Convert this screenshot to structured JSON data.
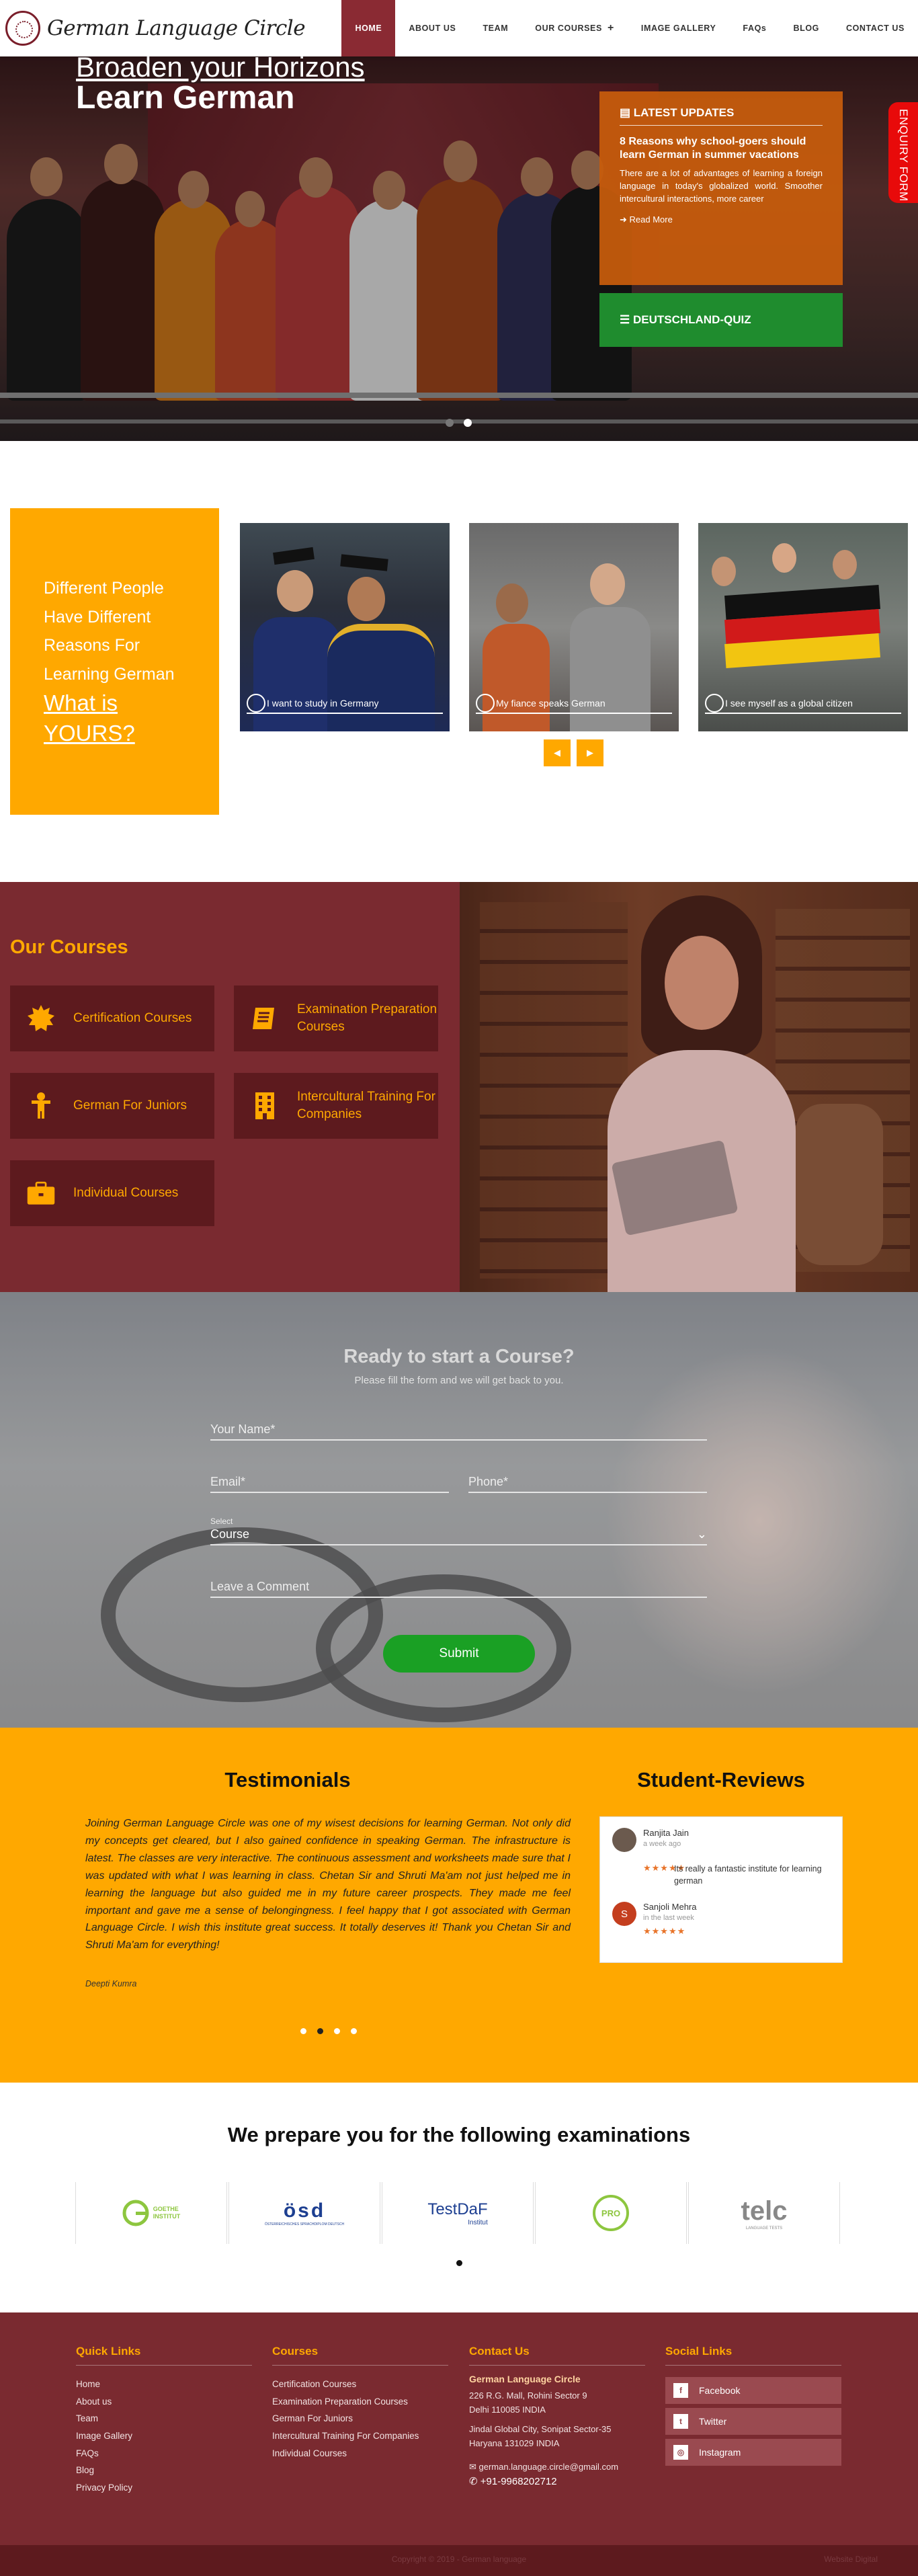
{
  "brand": {
    "name": "German Language Circle"
  },
  "nav": {
    "home": "HOME",
    "about": "ABOUT US",
    "team": "TEAM",
    "courses": "OUR COURSES",
    "gallery": "IMAGE GALLERY",
    "faqs": "FAQs",
    "blog": "BLOG",
    "contact": "CONTACT US"
  },
  "hero": {
    "line1": "Broaden your Horizons",
    "line2": "Learn German",
    "updates_heading": "LATEST UPDATES",
    "article_title": "8 Reasons why school-goers should learn German in summer vacations",
    "article_excerpt": "There are a lot of advantages of learning a foreign language in today's globalized world. Smoother intercultural interactions, more career",
    "read_more": "Read More",
    "quiz_label": "DEUTSCHLAND-QUIZ",
    "enquiry_label": "ENQUIRY FORM"
  },
  "reasons": {
    "lead": "Different People Have Different Reasons For Learning German",
    "question": "What is YOURS?",
    "cards": [
      {
        "caption": "I want to study in Germany"
      },
      {
        "caption": "My fiance speaks German"
      },
      {
        "caption": "I see myself as a global citizen"
      }
    ],
    "prev_glyph": "◀",
    "next_glyph": "▶"
  },
  "courses": {
    "title": "Our Courses",
    "items": [
      {
        "label": "Certification Courses",
        "icon": "certificate-icon"
      },
      {
        "label": "Examination Preparation Courses",
        "icon": "book-icon"
      },
      {
        "label": "German For Juniors",
        "icon": "child-icon"
      },
      {
        "label": "Intercultural Training For Companies",
        "icon": "building-icon"
      },
      {
        "label": "Individual Courses",
        "icon": "briefcase-icon"
      }
    ]
  },
  "form": {
    "title": "Ready to start a Course?",
    "subtitle": "Please fill the form and we will get back to you.",
    "name_placeholder": "Your Name*",
    "email_placeholder": "Email*",
    "phone_placeholder": "Phone*",
    "select_caption": "Select",
    "select_value": "Course",
    "comment_placeholder": "Leave a Comment",
    "submit": "Submit"
  },
  "testimonials": {
    "title": "Testimonials",
    "text": "Joining German Language Circle was one of my wisest decisions for learning German. Not only did my concepts get cleared, but I also gained confidence in speaking German. The infrastructure is latest. The classes are very interactive. The continuous assessment and worksheets made sure that I was updated with what I was learning in class. Chetan Sir and Shruti Ma'am not just helped me in learning the language but also guided me in my future career prospects. They made me feel important and gave me a sense of belongingness. I feel happy that I got associated with German Language Circle. I wish this institute great success. It totally deserves it! Thank you Chetan Sir and Shruti Ma'am for everything!",
    "author": "Deepti Kumra"
  },
  "reviews": {
    "title": "Student-Reviews",
    "items": [
      {
        "name": "Ranjita Jain",
        "time": "a week ago",
        "stars": "★★★★★",
        "comment": "Its really a fantastic institute for learning german",
        "initial": ""
      },
      {
        "name": "Sanjoli Mehra",
        "time": "in the last week",
        "stars": "★★★★★",
        "comment": "",
        "initial": "S"
      }
    ]
  },
  "exams": {
    "title": "We prepare you for the following examinations",
    "logos": [
      {
        "name": "goethe",
        "l1": "GOETHE",
        "l2": "INSTITUT"
      },
      {
        "name": "osd",
        "l1": "ösd",
        "l2": "ÖSTERREICHISCHES SPRACHDIPLOM DEUTSCH"
      },
      {
        "name": "testdaf",
        "l1": "TestDaF",
        "l2": "Institut"
      },
      {
        "name": "pro",
        "l1": "PRO",
        "l2": ""
      },
      {
        "name": "telc",
        "l1": "telc",
        "l2": "LANGUAGE TESTS"
      }
    ]
  },
  "footer": {
    "quick_links_title": "Quick Links",
    "quick_links": [
      "Home",
      "About us",
      "Team",
      "Image Gallery",
      "FAQs",
      "Blog",
      "Privacy Policy"
    ],
    "courses_title": "Courses",
    "course_links": [
      "Certification Courses",
      "Examination Preparation Courses",
      "German For Juniors",
      "Intercultural Training For Companies",
      "Individual Courses"
    ],
    "contact_title": "Contact Us",
    "org": "German Language Circle",
    "addr1a": "226 R.G. Mall, Rohini Sector 9",
    "addr1b": "Delhi 110085 INDIA",
    "addr2a": "Jindal Global City, Sonipat Sector-35",
    "addr2b": "Haryana 131029 INDIA",
    "email": "german.language.circle@gmail.com",
    "phone": "+91-9968202712",
    "social_title": "Social Links",
    "social": [
      "Facebook",
      "Twitter",
      "Instagram"
    ],
    "copyright": "Copyright © 2019 - German language",
    "powered": "Website Digital"
  },
  "colors": {
    "maroon": "#7a2a30",
    "amber": "#ffa800",
    "green": "#1aa024",
    "orange": "#c85c0c",
    "red": "#e80a0a"
  }
}
